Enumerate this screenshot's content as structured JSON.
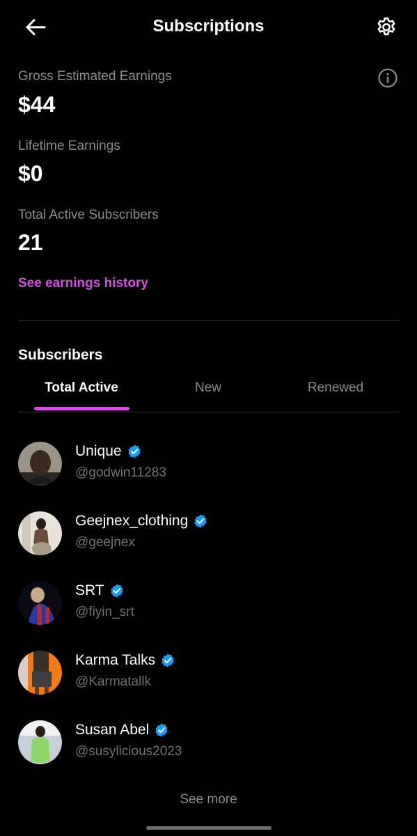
{
  "header": {
    "title": "Subscriptions",
    "back_icon": "arrow-left-icon",
    "settings_icon": "gear-icon"
  },
  "stats": {
    "gross_label": "Gross Estimated Earnings",
    "gross_value": "$44",
    "lifetime_label": "Lifetime Earnings",
    "lifetime_value": "$0",
    "active_label": "Total Active Subscribers",
    "active_value": "21",
    "info_icon": "info-icon"
  },
  "history_link": "See earnings history",
  "subscribers": {
    "title": "Subscribers",
    "tabs": [
      {
        "label": "Total Active",
        "active": true
      },
      {
        "label": "New",
        "active": false
      },
      {
        "label": "Renewed",
        "active": false
      }
    ],
    "list": [
      {
        "name": "Unique",
        "handle": "@godwin11283",
        "verified": true
      },
      {
        "name": "Geejnex_clothing",
        "handle": "@geejnex",
        "verified": true
      },
      {
        "name": "SRT",
        "handle": "@fiyin_srt",
        "verified": true
      },
      {
        "name": "Karma Talks",
        "handle": "@Karmatallk",
        "verified": true
      },
      {
        "name": "Susan Abel",
        "handle": "@susylicious2023",
        "verified": true
      }
    ]
  },
  "see_more": "See more",
  "colors": {
    "accent": "#d34fe0",
    "verified": "#1d9bf0",
    "background": "#000000"
  }
}
